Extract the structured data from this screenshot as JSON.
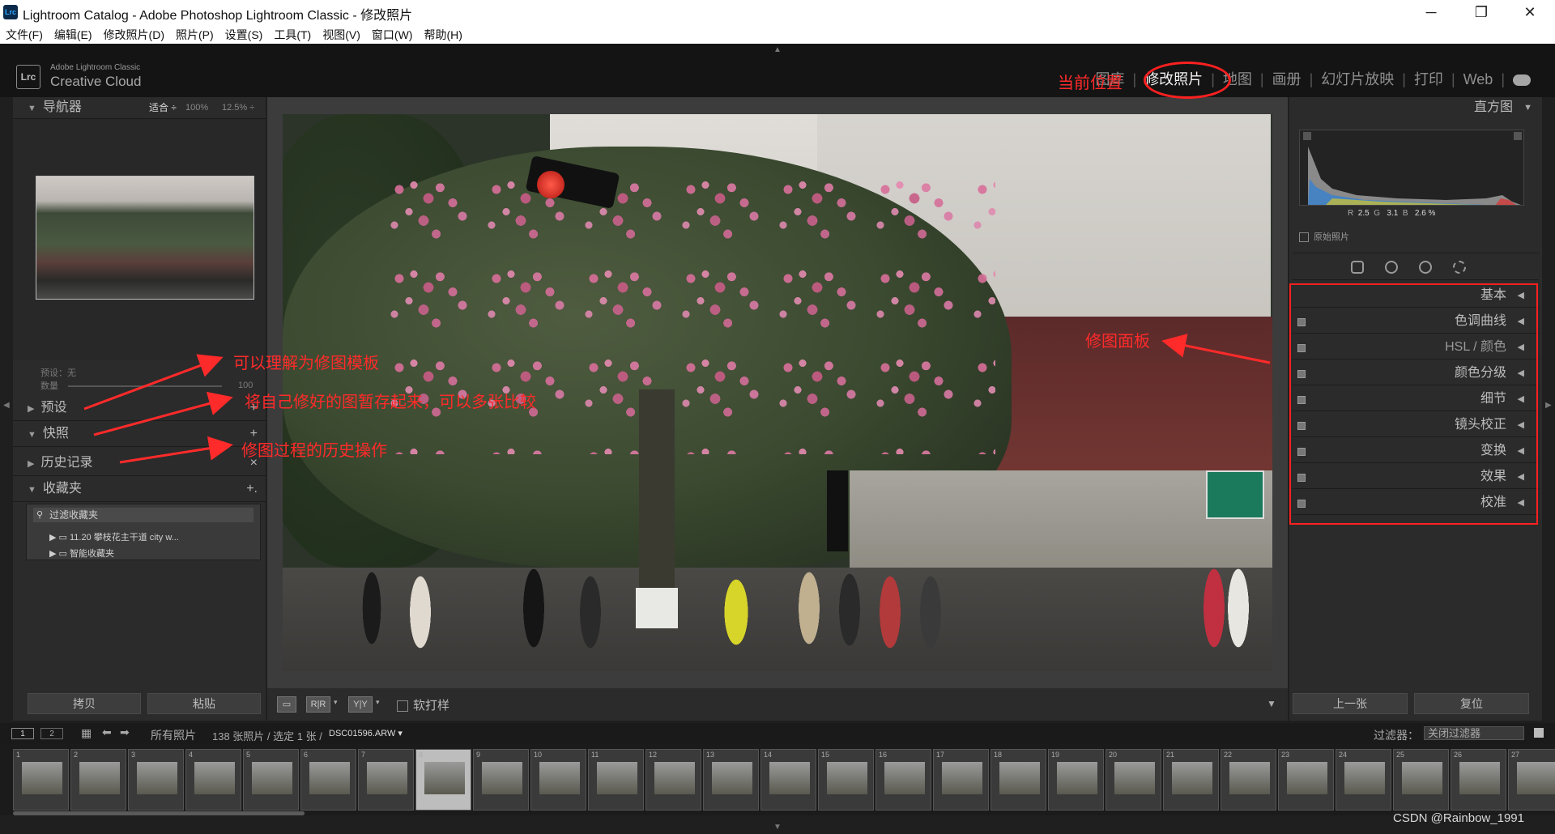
{
  "window": {
    "title": "Lightroom Catalog - Adobe Photoshop Lightroom Classic - 修改照片",
    "app_icon": "Lrc",
    "controls": [
      "minimize",
      "restore",
      "close"
    ]
  },
  "menu": [
    "文件(F)",
    "编辑(E)",
    "修改照片(D)",
    "照片(P)",
    "设置(S)",
    "工具(T)",
    "视图(V)",
    "窗口(W)",
    "帮助(H)"
  ],
  "brand": {
    "badge": "Lrc",
    "small": "Adobe Lightroom Classic",
    "big": "Creative Cloud"
  },
  "modules": [
    {
      "label": "图库",
      "active": false
    },
    {
      "label": "修改照片",
      "active": true
    },
    {
      "label": "地图",
      "active": false
    },
    {
      "label": "画册",
      "active": false
    },
    {
      "label": "幻灯片放映",
      "active": false
    },
    {
      "label": "打印",
      "active": false
    },
    {
      "label": "Web",
      "active": false
    }
  ],
  "left_panel": {
    "navigator": {
      "title": "导航器",
      "fit": "适合 ÷",
      "zoom1": "100%",
      "zoom2": "12.5% ÷"
    },
    "preset_info": {
      "preset_label": "预设：无",
      "amount_label": "数量",
      "amount_value": "100"
    },
    "sections": [
      {
        "label": "预设",
        "open": false,
        "action": "+"
      },
      {
        "label": "快照",
        "open": true,
        "action": "+"
      },
      {
        "label": "历史记录",
        "open": false,
        "action": "×"
      },
      {
        "label": "收藏夹",
        "open": true,
        "action": "+."
      }
    ],
    "collections": {
      "filter": "过滤收藏夹",
      "items": [
        "11.20 攀枝花主干道 city w...",
        "智能收藏夹"
      ]
    },
    "copy_button": "拷贝",
    "paste_button": "粘贴"
  },
  "center_toolbar": {
    "soft_proof": "软打样"
  },
  "right_panel": {
    "histogram": {
      "title": "直方图",
      "r_label": "R",
      "r_value": "2.5",
      "g_label": "G",
      "g_value": "3.1",
      "b_label": "B",
      "b_value": "2.6 %",
      "original": "原始照片"
    },
    "sections": [
      "基本",
      "色调曲线",
      "HSL / 颜色",
      "颜色分级",
      "细节",
      "镜头校正",
      "变换",
      "效果",
      "校准"
    ],
    "prev_button": "上一张",
    "reset_button": "复位"
  },
  "filmstrip": {
    "page1": "1",
    "page2": "2",
    "source": "所有照片",
    "count": "138 张照片 / 选定 1 张 /",
    "filename": "DSC01596.ARW",
    "filter_label": "过滤器：",
    "filter_value": "关闭过滤器",
    "frames": [
      "1",
      "2",
      "3",
      "4",
      "5",
      "6",
      "7",
      "8",
      "9",
      "10",
      "11",
      "12",
      "13",
      "14",
      "15",
      "16",
      "17",
      "18",
      "19",
      "20",
      "21",
      "22",
      "23",
      "24",
      "25",
      "26",
      "27"
    ],
    "selected": "8"
  },
  "annotations": {
    "current_position": "当前位置",
    "edit_panel": "修图面板",
    "presets_note": "可以理解为修图模板",
    "snapshots_note": "将自己修好的图暂存起来，可以多张比较",
    "history_note": "修图过程的历史操作"
  },
  "watermark": "CSDN @Rainbow_1991",
  "colors": {
    "annotation": "#ff2a2a",
    "panel": "#2b2b2b",
    "accent_light": "#f2f2f2"
  }
}
